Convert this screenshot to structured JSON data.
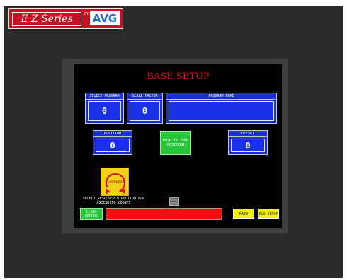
{
  "brand": {
    "series": "E Z Series",
    "by": "BY",
    "logo": "AVG"
  },
  "screen": {
    "title": "BASE SETUP",
    "select_program": {
      "label": "SELECT PROGRAM",
      "value": "0"
    },
    "scale_factor": {
      "label": "SCALE FACTOR",
      "value": "0"
    },
    "program_name": {
      "label": "PROGRAM NAME",
      "value": ""
    },
    "position": {
      "label": "POSITION",
      "value": "0"
    },
    "offset": {
      "label": "OFFSET",
      "value": "0"
    },
    "push_to_zero": "PUSH TO ZERO POSITION",
    "clockwise": "CLOCKWISE",
    "resolver_hint": "SELECT RESOLVER DIRECTION FOR ASCENDING COUNTS",
    "alarm_icon": "Alarm Status On",
    "clear_errors": "CLEAR ERRORS",
    "main": "MAIN",
    "pls_setup": "PLS SETUP"
  },
  "colors": {
    "screen_bg": "#000000",
    "panel": "#1c2fd4",
    "title": "#e8101a",
    "status_bar": "#ee1111"
  }
}
